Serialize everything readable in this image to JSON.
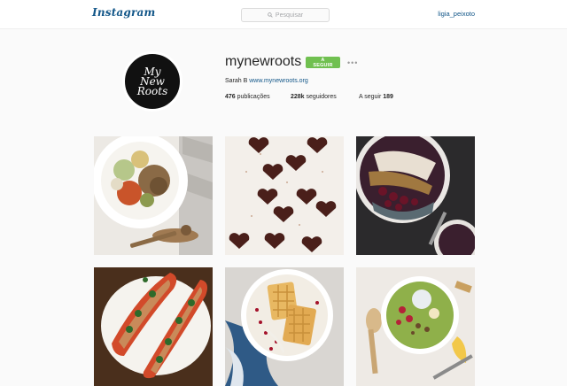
{
  "topbar": {
    "logo": "Instagram",
    "search_placeholder": "Pesquisar",
    "username": "ligia_peixoto"
  },
  "profile": {
    "avatar_text": [
      "My",
      "New",
      "Roots"
    ],
    "name": "mynewroots",
    "follow_label": "A SEGUIR",
    "more": "•••",
    "bio_name": "Sarah B",
    "bio_link": "www.mynewroots.org",
    "stats": [
      {
        "value": "476",
        "label": "publicações"
      },
      {
        "value": "228k",
        "label": "seguidores"
      },
      {
        "label": "A seguir",
        "value": "189"
      }
    ]
  },
  "colors": {
    "link": "#125688",
    "follow_button": "#70c050"
  },
  "posts": [
    {
      "name": "post-salad-bowl"
    },
    {
      "name": "post-chocolate-hearts"
    },
    {
      "name": "post-smoothie-bowl-berries"
    },
    {
      "name": "post-stuffed-sweet-potatoes"
    },
    {
      "name": "post-waffles"
    },
    {
      "name": "post-green-smoothie-bowl"
    }
  ]
}
